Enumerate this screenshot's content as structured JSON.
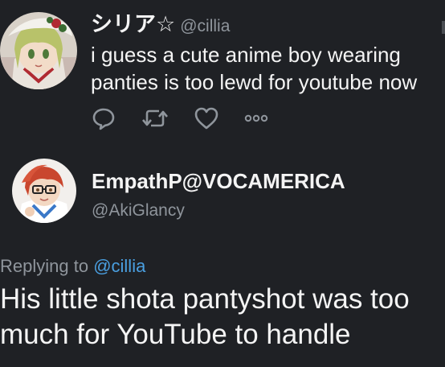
{
  "original_tweet": {
    "display_name": "シリア☆",
    "handle": "@cillia",
    "text": "i guess a cute anime boy wearing panties is too lewd for youtube now",
    "avatar_icon": "anime-girl-avatar",
    "actions": {
      "reply_icon": "reply-icon",
      "retweet_icon": "retweet-icon",
      "like_icon": "heart-icon",
      "more_icon": "more-options-icon"
    }
  },
  "reply_tweet": {
    "display_name": "EmpathP@VOCAMERICA",
    "handle": "@AkiGlancy",
    "avatar_icon": "anime-boy-avatar",
    "replying_prefix": "Replying to",
    "replying_to": "@cillia",
    "text": "His little shota pantyshot was too much for YouTube to handle"
  },
  "colors": {
    "background": "#1f2125",
    "primary_text": "#f4f4f4",
    "secondary_text": "#8f959c",
    "link": "#4a9fe0"
  }
}
